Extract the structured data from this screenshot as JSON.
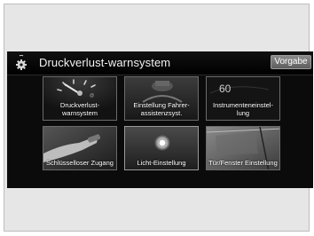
{
  "header": {
    "title": "Druckverlust-warnsystem",
    "default_button": "Vorgabe",
    "icon": "gear-icon"
  },
  "tiles": [
    {
      "label": "Druckverlust-\nwarnsystem",
      "icon": "tire-pressure-gauge-icon"
    },
    {
      "label": "Einstellung Fahrer-\nassistenzsyst.",
      "icon": "driver-assist-icon"
    },
    {
      "label": "Instrumenteneinstel-\nlung",
      "icon": "instrument-cluster-icon",
      "readout": "60"
    },
    {
      "label": "Schlüsselloser Zugang",
      "icon": "key-fob-icon"
    },
    {
      "label": "Licht-Einstellung",
      "icon": "headlight-icon"
    },
    {
      "label": "Tür/Fenster Einstellung",
      "icon": "door-window-icon"
    }
  ]
}
